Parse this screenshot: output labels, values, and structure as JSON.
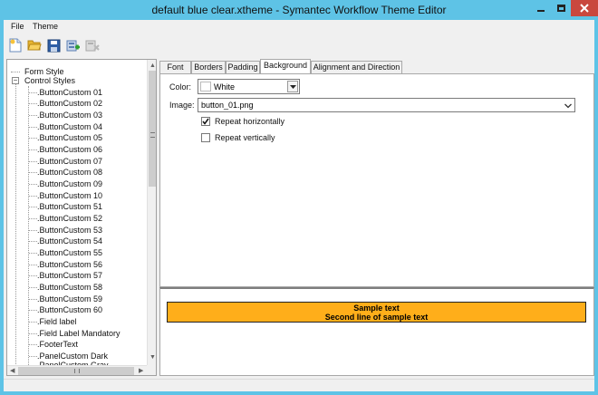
{
  "window": {
    "title": "default blue clear.xtheme - Symantec Workflow Theme Editor",
    "controls": {
      "minimize": "minimize-icon",
      "maximize": "maximize-icon",
      "close": "close-icon"
    }
  },
  "menu": {
    "file": "File",
    "theme": "Theme"
  },
  "toolbar": {
    "buttons": [
      {
        "name": "new-file-icon"
      },
      {
        "name": "open-folder-icon"
      },
      {
        "name": "save-icon"
      },
      {
        "name": "add-style-icon"
      },
      {
        "name": "delete-style-icon"
      }
    ]
  },
  "tree": {
    "root_items": [
      "Form Style",
      "Control Styles"
    ],
    "children": [
      ".ButtonCustom 01",
      ".ButtonCustom 02",
      ".ButtonCustom 03",
      ".ButtonCustom 04",
      ".ButtonCustom 05",
      ".ButtonCustom 06",
      ".ButtonCustom 07",
      ".ButtonCustom 08",
      ".ButtonCustom 09",
      ".ButtonCustom 10",
      ".ButtonCustom 51",
      ".ButtonCustom 52",
      ".ButtonCustom 53",
      ".ButtonCustom 54",
      ".ButtonCustom 55",
      ".ButtonCustom 56",
      ".ButtonCustom 57",
      ".ButtonCustom 58",
      ".ButtonCustom 59",
      ".ButtonCustom 60",
      ".Field label",
      ".Field Label Mandatory",
      ".FooterText",
      ".PanelCustom Dark",
      ".PanelCustom Gray"
    ],
    "expander": "−"
  },
  "tabs": [
    "Font",
    "Borders",
    "Padding",
    "Background",
    "Alignment and Direction"
  ],
  "active_tab": "Background",
  "background": {
    "color_label": "Color:",
    "color_value": "White",
    "image_label": "Image:",
    "image_value": "button_01.png",
    "repeat_h_label": "Repeat horizontally",
    "repeat_h_checked": true,
    "repeat_v_label": "Repeat vertically",
    "repeat_v_checked": false
  },
  "preview": {
    "line1": "Sample text",
    "line2": "Second line of sample text",
    "bg_color": "#ffae1a"
  },
  "colors": {
    "title_bar": "#5ec3e6",
    "close_button": "#c9483e",
    "window_face": "#f0f0f0"
  }
}
